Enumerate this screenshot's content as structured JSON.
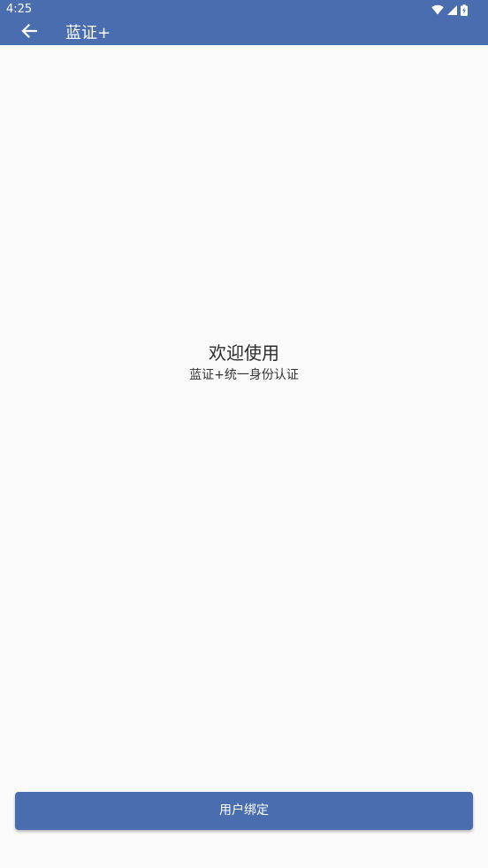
{
  "theme": {
    "primary": "#4a6daf",
    "background": "#fafafa"
  },
  "status_bar": {
    "time": "4:25",
    "icons": [
      "wifi-icon",
      "signal-icon",
      "battery-charging-icon"
    ]
  },
  "toolbar": {
    "back_icon": "arrow-left-icon",
    "title": "蓝证+"
  },
  "welcome": {
    "title": "欢迎使用",
    "subtitle": "蓝证+统一身份认证"
  },
  "actions": {
    "bind_label": "用户绑定"
  }
}
